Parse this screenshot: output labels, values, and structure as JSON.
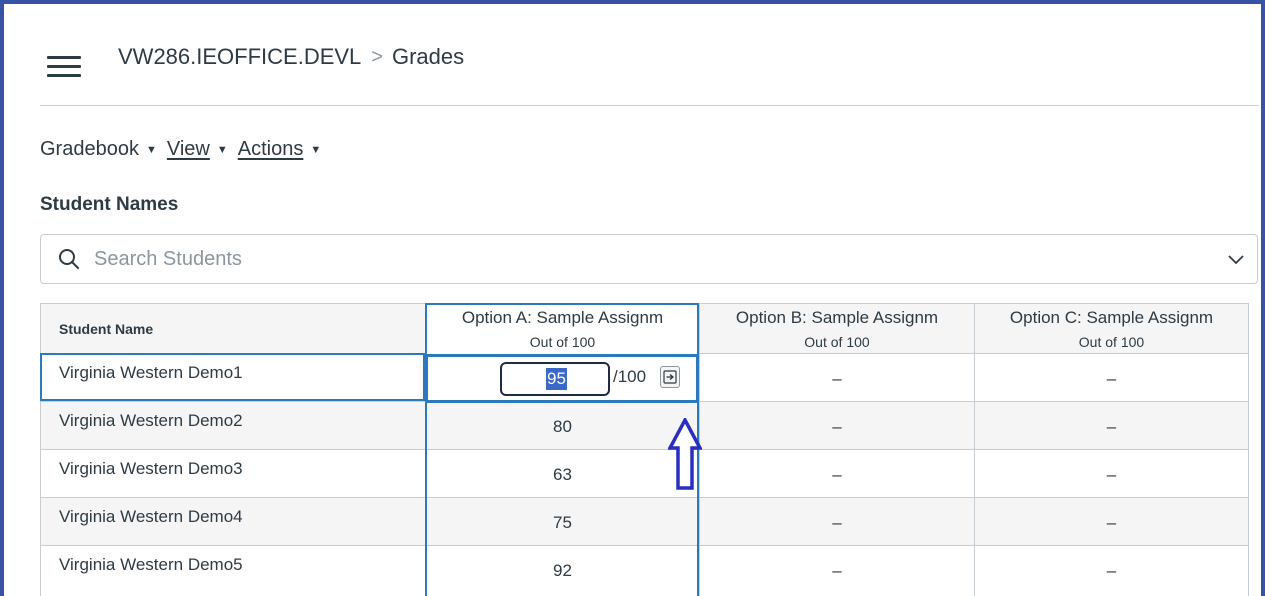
{
  "breadcrumb": {
    "course": "VW286.IEOFFICE.DEVL",
    "separator": ">",
    "current": "Grades"
  },
  "toolbar": {
    "gradebook_label": "Gradebook",
    "view_label": "View",
    "actions_label": "Actions"
  },
  "student_names_heading": "Student Names",
  "search": {
    "placeholder": "Search Students"
  },
  "grid": {
    "name_header": "Student Name",
    "columns": [
      {
        "title": "Option A: Sample Assignm",
        "subtitle": "Out of 100"
      },
      {
        "title": "Option B: Sample Assignm",
        "subtitle": "Out of 100"
      },
      {
        "title": "Option C: Sample Assignm",
        "subtitle": "Out of 100"
      }
    ],
    "rows": [
      {
        "name": "Virginia Western Demo1",
        "a": "95",
        "b": "–",
        "c": "–"
      },
      {
        "name": "Virginia Western Demo2",
        "a": "80",
        "b": "–",
        "c": "–"
      },
      {
        "name": "Virginia Western Demo3",
        "a": "63",
        "b": "–",
        "c": "–"
      },
      {
        "name": "Virginia Western Demo4",
        "a": "75",
        "b": "–",
        "c": "–"
      },
      {
        "name": "Virginia Western Demo5",
        "a": "92",
        "b": "–",
        "c": "–"
      }
    ],
    "edit": {
      "value": "95",
      "out_of": "/100"
    }
  },
  "colors": {
    "frame_border": "#3953a4",
    "active_cell": "#2b7abc",
    "selected_text_bg": "#3b68c9",
    "annotation_arrow": "#2a2fc2"
  },
  "icons": {
    "menu": "hamburger-icon",
    "search": "search-icon",
    "dropdown": "chevron-down-icon",
    "submit": "arrow-right-box-icon",
    "annotation": "up-arrow-icon"
  }
}
